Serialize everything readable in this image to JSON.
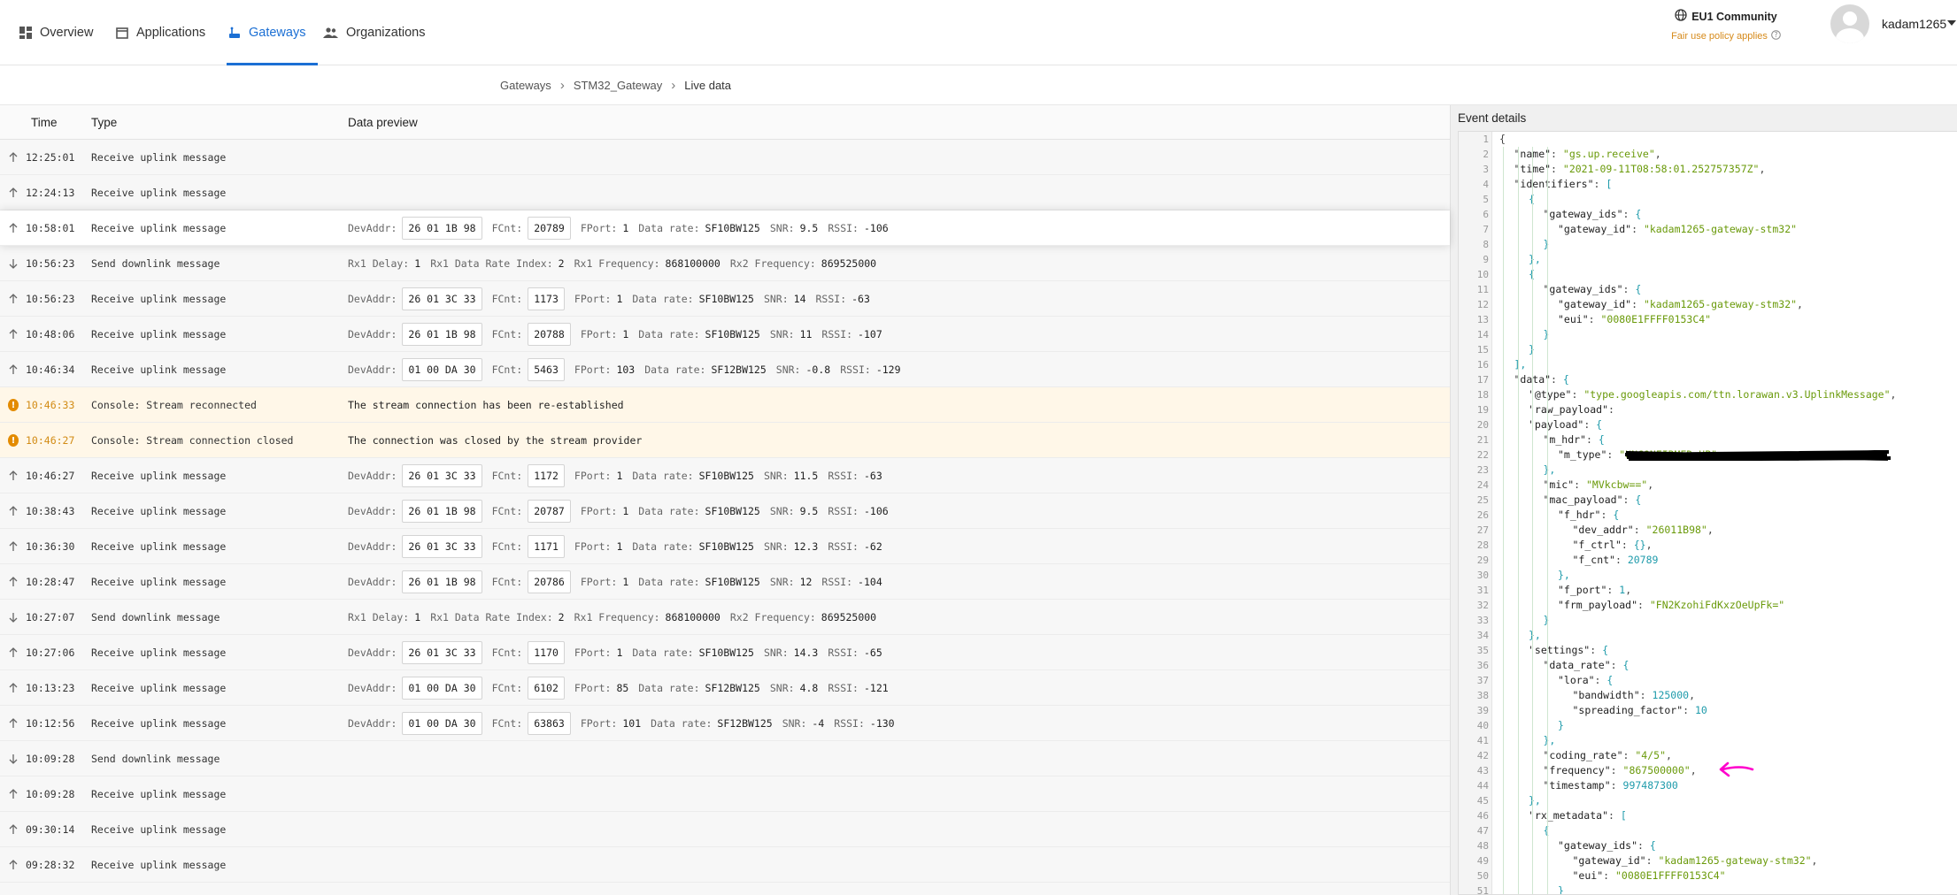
{
  "nav": {
    "tabs": [
      {
        "label": "Overview",
        "icon": "grid-icon"
      },
      {
        "label": "Applications",
        "icon": "window-icon"
      },
      {
        "label": "Gateways",
        "icon": "gateway-icon",
        "active": true
      },
      {
        "label": "Organizations",
        "icon": "people-icon"
      }
    ],
    "cluster": {
      "name": "EU1 Community",
      "policy": "Fair use policy applies"
    },
    "username": "kadam1265"
  },
  "breadcrumb": [
    "Gateways",
    "STM32_Gateway",
    "Live data"
  ],
  "table": {
    "headers": {
      "time": "Time",
      "type": "Type",
      "preview": "Data preview"
    },
    "rows": [
      {
        "dir": "up",
        "time": "12:25:01",
        "type": "Receive uplink message",
        "preview": null
      },
      {
        "dir": "up",
        "time": "12:24:13",
        "type": "Receive uplink message",
        "preview": null
      },
      {
        "dir": "up",
        "time": "10:58:01",
        "type": "Receive uplink message",
        "selected": true,
        "preview": {
          "kind": "uplink",
          "devaddr": "26 01 1B 98",
          "fcnt": "20789",
          "fport": "1",
          "datarate": "SF10BW125",
          "snr": "9.5",
          "rssi": "-106"
        }
      },
      {
        "dir": "down",
        "time": "10:56:23",
        "type": "Send downlink message",
        "preview": {
          "kind": "downlink",
          "rx1delay": "1",
          "rx1dri": "2",
          "rx1freq": "868100000",
          "rx2freq": "869525000"
        }
      },
      {
        "dir": "up",
        "time": "10:56:23",
        "type": "Receive uplink message",
        "preview": {
          "kind": "uplink",
          "devaddr": "26 01 3C 33",
          "fcnt": "1173",
          "fport": "1",
          "datarate": "SF10BW125",
          "snr": "14",
          "rssi": "-63"
        }
      },
      {
        "dir": "up",
        "time": "10:48:06",
        "type": "Receive uplink message",
        "preview": {
          "kind": "uplink",
          "devaddr": "26 01 1B 98",
          "fcnt": "20788",
          "fport": "1",
          "datarate": "SF10BW125",
          "snr": "11",
          "rssi": "-107"
        }
      },
      {
        "dir": "up",
        "time": "10:46:34",
        "type": "Receive uplink message",
        "preview": {
          "kind": "uplink",
          "devaddr": "01 00 DA 30",
          "fcnt": "5463",
          "fport": "103",
          "datarate": "SF12BW125",
          "snr": "-0.8",
          "rssi": "-129"
        }
      },
      {
        "dir": "warn",
        "time": "10:46:33",
        "type": "Console: Stream reconnected",
        "preview": {
          "kind": "text",
          "text": "The stream connection has been re-established"
        }
      },
      {
        "dir": "warn",
        "time": "10:46:27",
        "type": "Console: Stream connection closed",
        "preview": {
          "kind": "text",
          "text": "The connection was closed by the stream provider"
        }
      },
      {
        "dir": "up",
        "time": "10:46:27",
        "type": "Receive uplink message",
        "preview": {
          "kind": "uplink",
          "devaddr": "26 01 3C 33",
          "fcnt": "1172",
          "fport": "1",
          "datarate": "SF10BW125",
          "snr": "11.5",
          "rssi": "-63"
        }
      },
      {
        "dir": "up",
        "time": "10:38:43",
        "type": "Receive uplink message",
        "preview": {
          "kind": "uplink",
          "devaddr": "26 01 1B 98",
          "fcnt": "20787",
          "fport": "1",
          "datarate": "SF10BW125",
          "snr": "9.5",
          "rssi": "-106"
        }
      },
      {
        "dir": "up",
        "time": "10:36:30",
        "type": "Receive uplink message",
        "preview": {
          "kind": "uplink",
          "devaddr": "26 01 3C 33",
          "fcnt": "1171",
          "fport": "1",
          "datarate": "SF10BW125",
          "snr": "12.3",
          "rssi": "-62"
        }
      },
      {
        "dir": "up",
        "time": "10:28:47",
        "type": "Receive uplink message",
        "preview": {
          "kind": "uplink",
          "devaddr": "26 01 1B 98",
          "fcnt": "20786",
          "fport": "1",
          "datarate": "SF10BW125",
          "snr": "12",
          "rssi": "-104"
        }
      },
      {
        "dir": "down",
        "time": "10:27:07",
        "type": "Send downlink message",
        "preview": {
          "kind": "downlink",
          "rx1delay": "1",
          "rx1dri": "2",
          "rx1freq": "868100000",
          "rx2freq": "869525000"
        }
      },
      {
        "dir": "up",
        "time": "10:27:06",
        "type": "Receive uplink message",
        "preview": {
          "kind": "uplink",
          "devaddr": "26 01 3C 33",
          "fcnt": "1170",
          "fport": "1",
          "datarate": "SF10BW125",
          "snr": "14.3",
          "rssi": "-65"
        }
      },
      {
        "dir": "up",
        "time": "10:13:23",
        "type": "Receive uplink message",
        "preview": {
          "kind": "uplink",
          "devaddr": "01 00 DA 30",
          "fcnt": "6102",
          "fport": "85",
          "datarate": "SF12BW125",
          "snr": "4.8",
          "rssi": "-121"
        }
      },
      {
        "dir": "up",
        "time": "10:12:56",
        "type": "Receive uplink message",
        "preview": {
          "kind": "uplink",
          "devaddr": "01 00 DA 30",
          "fcnt": "63863",
          "fport": "101",
          "datarate": "SF12BW125",
          "snr": "-4",
          "rssi": "-130"
        }
      },
      {
        "dir": "down",
        "time": "10:09:28",
        "type": "Send downlink message",
        "preview": null
      },
      {
        "dir": "up",
        "time": "10:09:28",
        "type": "Receive uplink message",
        "preview": null
      },
      {
        "dir": "up",
        "time": "09:30:14",
        "type": "Receive uplink message",
        "preview": null
      },
      {
        "dir": "up",
        "time": "09:28:32",
        "type": "Receive uplink message",
        "preview": null
      }
    ],
    "labels": {
      "devaddr": "DevAddr:",
      "fcnt": "FCnt:",
      "fport": "FPort:",
      "datarate": "Data rate:",
      "snr": "SNR:",
      "rssi": "RSSI:",
      "rx1delay": "Rx1 Delay:",
      "rx1dri": "Rx1 Data Rate Index:",
      "rx1freq": "Rx1 Frequency:",
      "rx2freq": "Rx2 Frequency:"
    }
  },
  "details": {
    "title": "Event details",
    "lines": [
      [
        [
          0,
          "p",
          "{"
        ]
      ],
      [
        [
          1,
          "k",
          "\"name\""
        ],
        [
          1,
          "p",
          ": "
        ],
        [
          1,
          "s",
          "\"gs.up.receive\""
        ],
        [
          1,
          "p",
          ","
        ]
      ],
      [
        [
          1,
          "k",
          "\"time\""
        ],
        [
          1,
          "p",
          ": "
        ],
        [
          1,
          "s",
          "\"2021-09-11T08:58:01.252757357Z\""
        ],
        [
          1,
          "p",
          ","
        ]
      ],
      [
        [
          1,
          "k",
          "\"identifiers\""
        ],
        [
          1,
          "p",
          ": "
        ],
        [
          1,
          "b",
          "["
        ]
      ],
      [
        [
          2,
          "b",
          "{"
        ]
      ],
      [
        [
          3,
          "k",
          "\"gateway_ids\""
        ],
        [
          3,
          "p",
          ": "
        ],
        [
          3,
          "b",
          "{"
        ]
      ],
      [
        [
          4,
          "k",
          "\"gateway_id\""
        ],
        [
          4,
          "p",
          ": "
        ],
        [
          4,
          "s",
          "\"kadam1265-gateway-stm32\""
        ]
      ],
      [
        [
          3,
          "b",
          "}"
        ]
      ],
      [
        [
          2,
          "b",
          "},"
        ]
      ],
      [
        [
          2,
          "b",
          "{"
        ]
      ],
      [
        [
          3,
          "k",
          "\"gateway_ids\""
        ],
        [
          3,
          "p",
          ": "
        ],
        [
          3,
          "b",
          "{"
        ]
      ],
      [
        [
          4,
          "k",
          "\"gateway_id\""
        ],
        [
          4,
          "p",
          ": "
        ],
        [
          4,
          "s",
          "\"kadam1265-gateway-stm32\""
        ],
        [
          4,
          "p",
          ","
        ]
      ],
      [
        [
          4,
          "k",
          "\"eui\""
        ],
        [
          4,
          "p",
          ": "
        ],
        [
          4,
          "s",
          "\"0080E1FFFF0153C4\""
        ]
      ],
      [
        [
          3,
          "b",
          "}"
        ]
      ],
      [
        [
          2,
          "b",
          "}"
        ]
      ],
      [
        [
          1,
          "b",
          "],"
        ]
      ],
      [
        [
          1,
          "k",
          "\"data\""
        ],
        [
          1,
          "p",
          ": "
        ],
        [
          1,
          "b",
          "{"
        ]
      ],
      [
        [
          2,
          "k",
          "\"@type\""
        ],
        [
          2,
          "p",
          ": "
        ],
        [
          2,
          "s",
          "\"type.googleapis.com/ttn.lorawan.v3.UplinkMessage\""
        ],
        [
          2,
          "p",
          ","
        ]
      ],
      [
        [
          2,
          "k",
          "\"raw_payload\""
        ],
        [
          2,
          "p",
          ": "
        ]
      ],
      [
        [
          2,
          "k",
          "\"payload\""
        ],
        [
          2,
          "p",
          ": "
        ],
        [
          2,
          "b",
          "{"
        ]
      ],
      [
        [
          3,
          "k",
          "\"m_hdr\""
        ],
        [
          3,
          "p",
          ": "
        ],
        [
          3,
          "b",
          "{"
        ]
      ],
      [
        [
          4,
          "k",
          "\"m_type\""
        ],
        [
          4,
          "p",
          ": "
        ],
        [
          4,
          "s",
          "\"UNCONFIRMED_UP\""
        ]
      ],
      [
        [
          3,
          "b",
          "},"
        ]
      ],
      [
        [
          3,
          "k",
          "\"mic\""
        ],
        [
          3,
          "p",
          ": "
        ],
        [
          3,
          "s",
          "\"MVkcbw==\""
        ],
        [
          3,
          "p",
          ","
        ]
      ],
      [
        [
          3,
          "k",
          "\"mac_payload\""
        ],
        [
          3,
          "p",
          ": "
        ],
        [
          3,
          "b",
          "{"
        ]
      ],
      [
        [
          4,
          "k",
          "\"f_hdr\""
        ],
        [
          4,
          "p",
          ": "
        ],
        [
          4,
          "b",
          "{"
        ]
      ],
      [
        [
          5,
          "k",
          "\"dev_addr\""
        ],
        [
          5,
          "p",
          ": "
        ],
        [
          5,
          "s",
          "\"26011B98\""
        ],
        [
          5,
          "p",
          ","
        ]
      ],
      [
        [
          5,
          "k",
          "\"f_ctrl\""
        ],
        [
          5,
          "p",
          ": "
        ],
        [
          5,
          "b",
          "{}"
        ],
        [
          5,
          "p",
          ","
        ]
      ],
      [
        [
          5,
          "k",
          "\"f_cnt\""
        ],
        [
          5,
          "p",
          ": "
        ],
        [
          5,
          "n",
          "20789"
        ]
      ],
      [
        [
          4,
          "b",
          "},"
        ]
      ],
      [
        [
          4,
          "k",
          "\"f_port\""
        ],
        [
          4,
          "p",
          ": "
        ],
        [
          4,
          "n",
          "1"
        ],
        [
          4,
          "p",
          ","
        ]
      ],
      [
        [
          4,
          "k",
          "\"frm_payload\""
        ],
        [
          4,
          "p",
          ": "
        ],
        [
          4,
          "s",
          "\"FN2KzohiFdKxzOeUpFk=\""
        ]
      ],
      [
        [
          3,
          "b",
          "}"
        ]
      ],
      [
        [
          2,
          "b",
          "},"
        ]
      ],
      [
        [
          2,
          "k",
          "\"settings\""
        ],
        [
          2,
          "p",
          ": "
        ],
        [
          2,
          "b",
          "{"
        ]
      ],
      [
        [
          3,
          "k",
          "\"data_rate\""
        ],
        [
          3,
          "p",
          ": "
        ],
        [
          3,
          "b",
          "{"
        ]
      ],
      [
        [
          4,
          "k",
          "\"lora\""
        ],
        [
          4,
          "p",
          ": "
        ],
        [
          4,
          "b",
          "{"
        ]
      ],
      [
        [
          5,
          "k",
          "\"bandwidth\""
        ],
        [
          5,
          "p",
          ": "
        ],
        [
          5,
          "n",
          "125000"
        ],
        [
          5,
          "p",
          ","
        ]
      ],
      [
        [
          5,
          "k",
          "\"spreading_factor\""
        ],
        [
          5,
          "p",
          ": "
        ],
        [
          5,
          "n",
          "10"
        ]
      ],
      [
        [
          4,
          "b",
          "}"
        ]
      ],
      [
        [
          3,
          "b",
          "},"
        ]
      ],
      [
        [
          3,
          "k",
          "\"coding_rate\""
        ],
        [
          3,
          "p",
          ": "
        ],
        [
          3,
          "s",
          "\"4/5\""
        ],
        [
          3,
          "p",
          ","
        ]
      ],
      [
        [
          3,
          "k",
          "\"frequency\""
        ],
        [
          3,
          "p",
          ": "
        ],
        [
          3,
          "s",
          "\"867500000\""
        ],
        [
          3,
          "p",
          ","
        ]
      ],
      [
        [
          3,
          "k",
          "\"timestamp\""
        ],
        [
          3,
          "p",
          ": "
        ],
        [
          3,
          "n",
          "997487300"
        ]
      ],
      [
        [
          2,
          "b",
          "},"
        ]
      ],
      [
        [
          2,
          "k",
          "\"rx_metadata\""
        ],
        [
          2,
          "p",
          ": "
        ],
        [
          2,
          "b",
          "["
        ]
      ],
      [
        [
          3,
          "b",
          "{"
        ]
      ],
      [
        [
          4,
          "k",
          "\"gateway_ids\""
        ],
        [
          4,
          "p",
          ": "
        ],
        [
          4,
          "b",
          "{"
        ]
      ],
      [
        [
          5,
          "k",
          "\"gateway_id\""
        ],
        [
          5,
          "p",
          ": "
        ],
        [
          5,
          "s",
          "\"kadam1265-gateway-stm32\""
        ],
        [
          5,
          "p",
          ","
        ]
      ],
      [
        [
          5,
          "k",
          "\"eui\""
        ],
        [
          5,
          "p",
          ": "
        ],
        [
          5,
          "s",
          "\"0080E1FFFF0153C4\""
        ]
      ],
      [
        [
          4,
          "b",
          "}"
        ]
      ]
    ]
  },
  "colors": {
    "accent": "#1b6fd4",
    "warning": "#e38b00",
    "json_string": "#6a9a0a",
    "json_number": "#1f9bab",
    "annotation": "#ff00cc"
  }
}
